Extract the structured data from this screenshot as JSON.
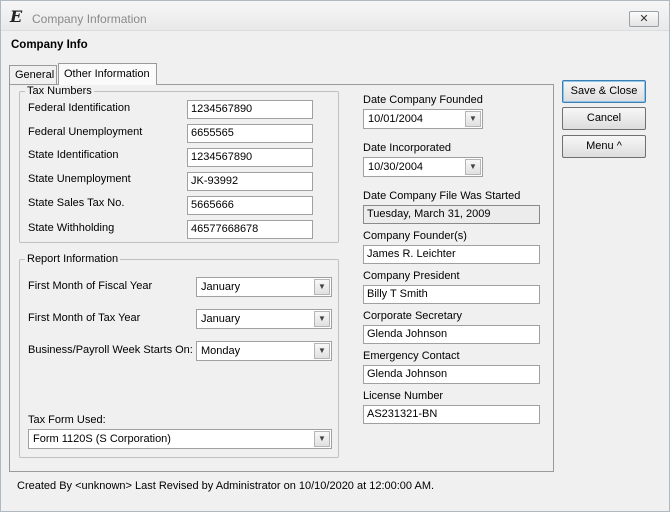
{
  "window": {
    "title": "Company Information",
    "app_icon": "E",
    "close_glyph": "✕"
  },
  "header": {
    "title": "Company Info"
  },
  "tabs": [
    {
      "label": "General",
      "selected": false
    },
    {
      "label": "Other Information",
      "selected": true
    }
  ],
  "tax_numbers": {
    "legend": "Tax Numbers",
    "fields": [
      {
        "label": "Federal Identification",
        "value": "1234567890"
      },
      {
        "label": "Federal Unemployment",
        "value": "6655565"
      },
      {
        "label": "State Identification",
        "value": "1234567890"
      },
      {
        "label": "State Unemployment",
        "value": "JK-93992"
      },
      {
        "label": "State Sales Tax No.",
        "value": "5665666"
      },
      {
        "label": "State Withholding",
        "value": "46577668678"
      }
    ]
  },
  "report_info": {
    "legend": "Report Information",
    "fiscal_label": "First Month of Fiscal Year",
    "fiscal_value": "January",
    "tax_year_label": "First Month of Tax Year",
    "tax_year_value": "January",
    "week_label": "Business/Payroll Week Starts On:",
    "week_value": "Monday",
    "tax_form_label": "Tax Form Used:",
    "tax_form_value": "Form 1120S (S Corporation)"
  },
  "company": {
    "founded_label": "Date Company Founded",
    "founded_value": "10/01/2004",
    "incorporated_label": "Date Incorporated",
    "incorporated_value": "10/30/2004",
    "file_started_label": "Date Company File Was Started",
    "file_started_value": "Tuesday, March 31, 2009",
    "founders_label": "Company Founder(s)",
    "founders_value": "James R. Leichter",
    "president_label": "Company President",
    "president_value": "Billy T Smith",
    "secretary_label": "Corporate Secretary",
    "secretary_value": "Glenda Johnson",
    "emergency_label": "Emergency Contact",
    "emergency_value": "Glenda Johnson",
    "license_label": "License Number",
    "license_value": "AS231321-BN"
  },
  "buttons": {
    "save_close": "Save & Close",
    "cancel": "Cancel",
    "menu": "Menu ^"
  },
  "footer": {
    "text": "Created By <unknown> Last Revised by Administrator on 10/10/2020 at 12:00:00 AM."
  },
  "icons": {
    "dropdown_arrow": "chevron-down-icon"
  }
}
